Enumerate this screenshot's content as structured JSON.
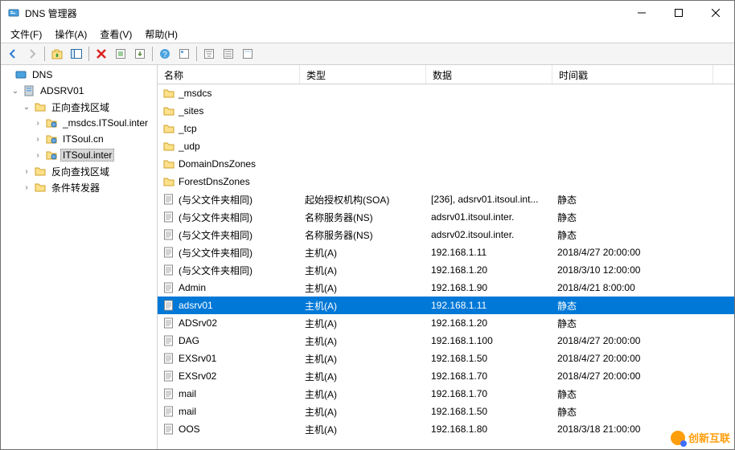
{
  "window": {
    "title": "DNS 管理器"
  },
  "menubar": [
    "文件(F)",
    "操作(A)",
    "查看(V)",
    "帮助(H)"
  ],
  "tree": {
    "root": "DNS",
    "server": "ADSRV01",
    "fwd": "正向查找区域",
    "zones": [
      "_msdcs.ITSoul.inter",
      "ITSoul.cn",
      "ITSoul.inter"
    ],
    "rev": "反向查找区域",
    "cond": "条件转发器"
  },
  "columns": [
    "名称",
    "类型",
    "数据",
    "时间戳"
  ],
  "records": [
    {
      "icon": "folder",
      "name": "_msdcs",
      "type": "",
      "data": "",
      "ts": ""
    },
    {
      "icon": "folder",
      "name": "_sites",
      "type": "",
      "data": "",
      "ts": ""
    },
    {
      "icon": "folder",
      "name": "_tcp",
      "type": "",
      "data": "",
      "ts": ""
    },
    {
      "icon": "folder",
      "name": "_udp",
      "type": "",
      "data": "",
      "ts": ""
    },
    {
      "icon": "folder",
      "name": "DomainDnsZones",
      "type": "",
      "data": "",
      "ts": ""
    },
    {
      "icon": "folder",
      "name": "ForestDnsZones",
      "type": "",
      "data": "",
      "ts": ""
    },
    {
      "icon": "rec",
      "name": "(与父文件夹相同)",
      "type": "起始授权机构(SOA)",
      "data": "[236], adsrv01.itsoul.int...",
      "ts": "静态"
    },
    {
      "icon": "rec",
      "name": "(与父文件夹相同)",
      "type": "名称服务器(NS)",
      "data": "adsrv01.itsoul.inter.",
      "ts": "静态"
    },
    {
      "icon": "rec",
      "name": "(与父文件夹相同)",
      "type": "名称服务器(NS)",
      "data": "adsrv02.itsoul.inter.",
      "ts": "静态"
    },
    {
      "icon": "rec",
      "name": "(与父文件夹相同)",
      "type": "主机(A)",
      "data": "192.168.1.11",
      "ts": "2018/4/27 20:00:00"
    },
    {
      "icon": "rec",
      "name": "(与父文件夹相同)",
      "type": "主机(A)",
      "data": "192.168.1.20",
      "ts": "2018/3/10 12:00:00"
    },
    {
      "icon": "rec",
      "name": "Admin",
      "type": "主机(A)",
      "data": "192.168.1.90",
      "ts": "2018/4/21 8:00:00"
    },
    {
      "icon": "rec",
      "name": "adsrv01",
      "type": "主机(A)",
      "data": "192.168.1.11",
      "ts": "静态",
      "selected": true
    },
    {
      "icon": "rec",
      "name": "ADSrv02",
      "type": "主机(A)",
      "data": "192.168.1.20",
      "ts": "静态"
    },
    {
      "icon": "rec",
      "name": "DAG",
      "type": "主机(A)",
      "data": "192.168.1.100",
      "ts": "2018/4/27 20:00:00"
    },
    {
      "icon": "rec",
      "name": "EXSrv01",
      "type": "主机(A)",
      "data": "192.168.1.50",
      "ts": "2018/4/27 20:00:00"
    },
    {
      "icon": "rec",
      "name": "EXSrv02",
      "type": "主机(A)",
      "data": "192.168.1.70",
      "ts": "2018/4/27 20:00:00"
    },
    {
      "icon": "rec",
      "name": "mail",
      "type": "主机(A)",
      "data": "192.168.1.70",
      "ts": "静态"
    },
    {
      "icon": "rec",
      "name": "mail",
      "type": "主机(A)",
      "data": "192.168.1.50",
      "ts": "静态"
    },
    {
      "icon": "rec",
      "name": "OOS",
      "type": "主机(A)",
      "data": "192.168.1.80",
      "ts": "2018/3/18 21:00:00"
    }
  ],
  "watermark": "创新互联"
}
